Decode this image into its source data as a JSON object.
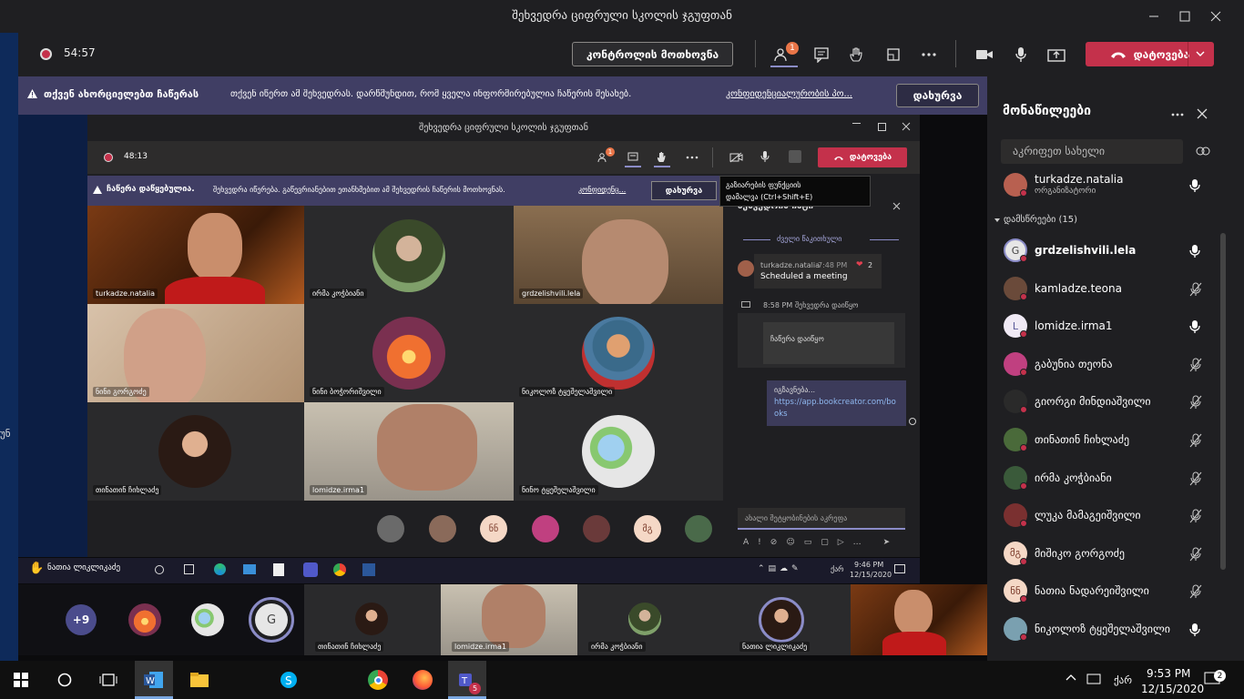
{
  "window": {
    "title": "შეხვედრა ციფრული სკოლის ჯგუფთან"
  },
  "toolbar": {
    "timer": "54:57",
    "request_control": "კონტროლის მოთხოვნა",
    "participants_badge": "1",
    "leave": "დატოვება"
  },
  "banner": {
    "bold": "თქვენ ახორციელებთ ჩაწერას",
    "text": "თქვენ იწერთ ამ შეხვედრას. დარწმუნდით, რომ ყველა ინფორმირებულია ჩაწერის შესახებ.",
    "link": "კონფიდენციალურობის პო...",
    "dismiss": "დახურვა"
  },
  "inner": {
    "title": "შეხვედრა ციფრული სკოლის ჯგუფთან",
    "timer": "48:13",
    "badge": "1",
    "leave": "დატოვება",
    "banner_bold": "ჩაწერა დაწყებულია.",
    "banner_text": "შეხვედრა იწერება. გაწევრიანებით ეთანხმებით ამ შეხვედრის ჩაწერის მოთხოვნას.",
    "banner_link": "კონფიდენც...",
    "banner_dismiss": "დახურვა",
    "tooltip_line1": "გაზიარების ფუნქციის",
    "tooltip_line2": "დამალვა (Ctrl+Shift+E)",
    "tiles": [
      {
        "name": "turkadze.natalia"
      },
      {
        "name": "ირმა კოჭბიანი"
      },
      {
        "name": "grdzelishvili.lela"
      },
      {
        "name": "ნინი გორგოძე"
      },
      {
        "name": "ნინი ბოჭორიშვილი"
      },
      {
        "name": "ნიკოლოზ ტყეშელაშვილი"
      },
      {
        "name": "თინათინ ჩიხლაძე"
      },
      {
        "name": "lomidze.irma1"
      },
      {
        "name": "ნინო ტყეშელაშვილი"
      }
    ],
    "strip_initials": [
      "ნნ",
      "მგ"
    ],
    "chat": {
      "header": "შეხვედრის ჩატი",
      "old_messages": "ძველი წაკითხული",
      "msg_author": "turkadze.natalia",
      "msg_time": "7:48 PM",
      "msg_text": "Scheduled a meeting",
      "reaction_count": "2",
      "event_time": "8:58 PM",
      "event_text": "შეხვედრა დაიწყო",
      "recording_started": "ჩაწერა დაიწყო",
      "link_text": "იგზავნება...",
      "link_url1": "https://app.bookcreator.com/bo",
      "link_url2": "oks",
      "compose_placeholder": "ახალი შეტყობინების აკრეფა"
    },
    "taskbar_time": "9:46 PM",
    "taskbar_date": "12/15/2020",
    "taskbar_lang": "ქარ",
    "raised_hand_name": "ნათია ლიკლიკაძე"
  },
  "stripe": {
    "more_count": "+9",
    "g_initial": "G",
    "tiles": [
      {
        "name": "თინათინ ჩიხლაძე"
      },
      {
        "name": "lomidze.irma1"
      },
      {
        "name": "ირმა კოჭბიანი"
      },
      {
        "name": "ნათია ლიკლიკაძე"
      }
    ]
  },
  "panel": {
    "title": "მონაწილეები",
    "search_placeholder": "აკრიფეთ სახელი",
    "organizer_name": "turkadze.natalia",
    "organizer_role": "ორგანიზატორი",
    "attendees_label": "დამსწრეები (15)",
    "attendees": [
      {
        "name": "grdzelishvili.lela",
        "initials": "G",
        "muted": false
      },
      {
        "name": "kamladze.teona",
        "muted": true
      },
      {
        "name": "lomidze.irma1",
        "initials": "L",
        "muted": false
      },
      {
        "name": "გაბუნია თეონა",
        "muted": true
      },
      {
        "name": "გიორგი მინდიაშვილი",
        "muted": true
      },
      {
        "name": "თინათინ ჩიხლაძე",
        "muted": true
      },
      {
        "name": "ირმა კოჭბიანი",
        "muted": true
      },
      {
        "name": "ლუკა მამაგეიშვილი",
        "muted": true
      },
      {
        "name": "მიშიკო გორგოძე",
        "initials": "მგ",
        "muted": true
      },
      {
        "name": "ნათია ნადარეიშვილი",
        "initials": "ნნ",
        "muted": true
      },
      {
        "name": "ნიკოლოზ ტყეშელაშვილი",
        "muted": false
      }
    ]
  },
  "taskbar": {
    "time": "9:53 PM",
    "date": "12/15/2020",
    "lang": "ქარ",
    "notifications": "2",
    "teams_badge": "5"
  },
  "desktop": {
    "left_glyph": "უნ"
  }
}
